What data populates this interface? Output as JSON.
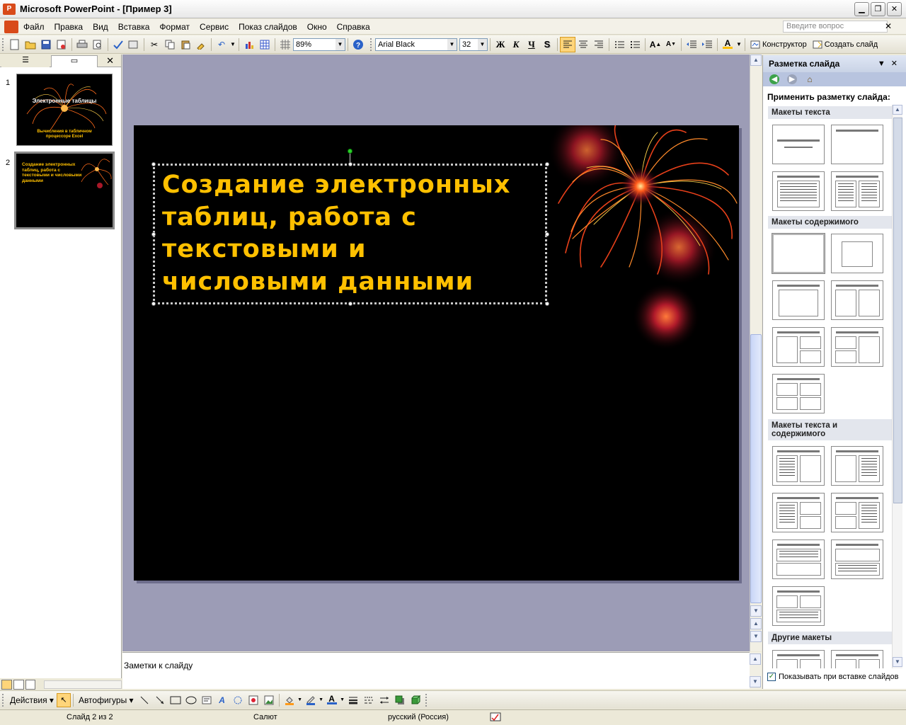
{
  "window": {
    "title": "Microsoft PowerPoint - [Пример 3]",
    "app_icon_glyph": "P",
    "buttons": {
      "minimize": "▁",
      "restore": "❐",
      "close": "✕"
    }
  },
  "menu": {
    "items": [
      {
        "label": "Файл"
      },
      {
        "label": "Правка"
      },
      {
        "label": "Вид"
      },
      {
        "label": "Вставка"
      },
      {
        "label": "Формат"
      },
      {
        "label": "Сервис"
      },
      {
        "label": "Показ слайдов"
      },
      {
        "label": "Окно"
      },
      {
        "label": "Справка"
      }
    ],
    "help_placeholder": "Введите вопрос",
    "close_glyph": "✕"
  },
  "toolbar": {
    "zoom": "89%",
    "font": "Arial Black",
    "font_size": "32",
    "bold": "Ж",
    "italic": "К",
    "underline": "Ч",
    "shadow": "S",
    "designer": "Конструктор",
    "new_slide": "Создать слайд"
  },
  "left_panel": {
    "tab_outline_glyph": "☰",
    "tab_slides_glyph": "▭",
    "close_glyph": "✕",
    "slides": [
      {
        "number": "1",
        "title": "Электронные таблицы",
        "subtitle": "Вычисления в табличном процессоре Excel"
      },
      {
        "number": "2",
        "title": "Создание электронных таблиц, работа с текстовыми и числовыми данными"
      }
    ]
  },
  "slide": {
    "title_lines": [
      "Создание электронных",
      "таблиц, работа с",
      "текстовыми и",
      "числовыми данными"
    ]
  },
  "notes": {
    "placeholder": "Заметки к слайду"
  },
  "task_pane": {
    "title": "Разметка слайда",
    "apply_label": "Применить разметку слайда:",
    "sections": {
      "text": "Макеты текста",
      "content": "Макеты содержимого",
      "text_content": "Макеты текста и содержимого",
      "other": "Другие макеты"
    },
    "show_on_insert": "Показывать при вставке слайдов"
  },
  "draw_toolbar": {
    "actions": "Действия",
    "autoshapes": "Автофигуры"
  },
  "status": {
    "slide_info": "Слайд 2 из 2",
    "design": "Салют",
    "language": "русский (Россия)"
  },
  "colors": {
    "title_text": "#ffc000",
    "slide_bg": "#000000",
    "workspace_bg": "#9c9cb6",
    "taskpane_header": "#c9d3e6"
  }
}
